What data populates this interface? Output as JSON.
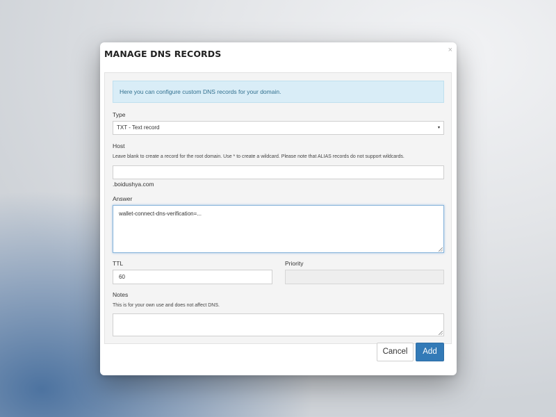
{
  "modal": {
    "title": "MANAGE DNS RECORDS",
    "close_glyph": "×",
    "info_text": "Here you can configure custom DNS records for your domain."
  },
  "form": {
    "type": {
      "label": "Type",
      "value": "TXT - Text record",
      "caret_glyph": "▾"
    },
    "host": {
      "label": "Host",
      "help": "Leave blank to create a record for the root domain. Use * to create a wildcard. Please note that ALIAS records do not support wildcards.",
      "value": "",
      "domain_suffix": ".boidushya.com"
    },
    "answer": {
      "label": "Answer",
      "value": "wallet-connect-dns-verification=..."
    },
    "ttl": {
      "label": "TTL",
      "value": "60"
    },
    "priority": {
      "label": "Priority",
      "value": ""
    },
    "notes": {
      "label": "Notes",
      "help": "This is for your own use and does not affect DNS.",
      "value": ""
    }
  },
  "buttons": {
    "cancel": "Cancel",
    "add": "Add"
  },
  "colors": {
    "primary": "#337ab7",
    "info_bg": "#d9edf7",
    "info_text": "#31708f"
  }
}
